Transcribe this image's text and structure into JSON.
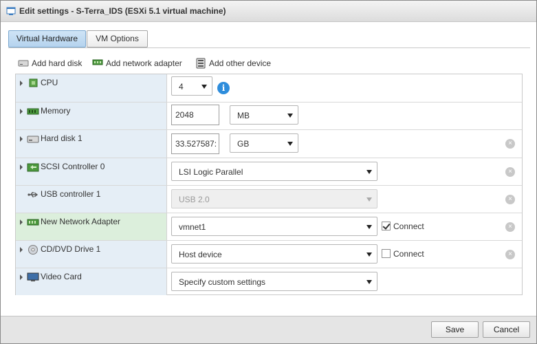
{
  "window": {
    "title": "Edit settings - S-Terra_IDS (ESXi 5.1 virtual machine)"
  },
  "tabs": [
    {
      "label": "Virtual Hardware",
      "active": true
    },
    {
      "label": "VM Options",
      "active": false
    }
  ],
  "toolbar": {
    "add_hard_disk": "Add hard disk",
    "add_network_adapter": "Add network adapter",
    "add_other_device": "Add other device"
  },
  "devices": {
    "cpu": {
      "label": "CPU",
      "value": "4"
    },
    "memory": {
      "label": "Memory",
      "value": "2048",
      "unit": "MB"
    },
    "hard_disk": {
      "label": "Hard disk 1",
      "value": "33.527587:",
      "unit": "GB"
    },
    "scsi": {
      "label": "SCSI Controller 0",
      "value": "LSI Logic Parallel"
    },
    "usb": {
      "label": "USB controller 1",
      "value": "USB 2.0"
    },
    "network": {
      "label": "New Network Adapter",
      "value": "vmnet1",
      "connect_label": "Connect",
      "connected": true
    },
    "cddvd": {
      "label": "CD/DVD Drive 1",
      "value": "Host device",
      "connect_label": "Connect",
      "connected": false
    },
    "video": {
      "label": "Video Card",
      "value": "Specify custom settings"
    }
  },
  "icons": {
    "info": "i",
    "remove": "×"
  },
  "footer": {
    "save_label": "Save",
    "cancel_label": "Cancel"
  },
  "colors": {
    "label_bg": "#e5eef6",
    "highlight_bg": "#dcefdc",
    "active_tab": "#b5d3ee",
    "info_blue": "#2e8ddc"
  }
}
